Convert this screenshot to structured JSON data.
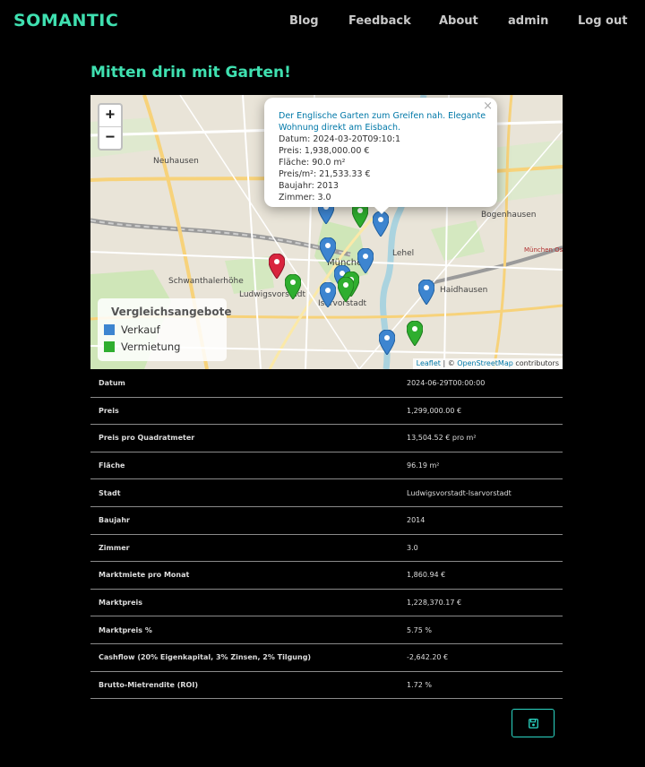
{
  "nav": {
    "brand": "SOMANTIC",
    "links": [
      "Blog",
      "Feedback",
      "About",
      "admin",
      "Log out"
    ]
  },
  "page": {
    "title": "Mitten drin mit Garten!"
  },
  "map": {
    "zoom_in": "+",
    "zoom_out": "−",
    "place_labels": [
      "Neuhausen",
      "Bogenhausen",
      "Schwanthalerhöhe",
      "Ludwigsvorstadt",
      "Isarvorstadt",
      "München",
      "Lehel",
      "Haidhausen",
      "München Ost"
    ],
    "popup": {
      "close": "×",
      "link_text": "Der Englische Garten zum Greifen nah. Elegante Wohnung direkt am Eisbach.",
      "lines": [
        "Datum: 2024-03-20T09:10:1",
        "Preis: 1,938,000.00 €",
        "Fläche: 90.0 m²",
        "Preis/m²: 21,533.33 €",
        "Baujahr: 2013",
        "Zimmer: 3.0"
      ]
    },
    "legend": {
      "title": "Vergleichsangebote",
      "items": [
        {
          "label": "Verkauf",
          "color": "#3d85d0"
        },
        {
          "label": "Vermietung",
          "color": "#2fae2f"
        }
      ]
    },
    "attribution": {
      "leaflet": "Leaflet",
      "separator": " | © ",
      "osm": "OpenStreetMap",
      "rest": " contributors"
    },
    "colors": {
      "sale": "#3d85d0",
      "rent": "#2fae2f",
      "current": "#d9243e"
    }
  },
  "details": [
    {
      "key": "Datum",
      "value": "2024-06-29T00:00:00"
    },
    {
      "key": "Preis",
      "value": "1,299,000.00 €"
    },
    {
      "key": "Preis pro Quadratmeter",
      "value": "13,504.52 € pro m²"
    },
    {
      "key": "Fläche",
      "value": "96.19 m²"
    },
    {
      "key": "Stadt",
      "value": "Ludwigsvorstadt-Isarvorstadt"
    },
    {
      "key": "Baujahr",
      "value": "2014"
    },
    {
      "key": "Zimmer",
      "value": "3.0"
    },
    {
      "key": "Marktmiete pro Monat",
      "value": "1,860.94 €"
    },
    {
      "key": "Marktpreis",
      "value": "1,228,370.17 €"
    },
    {
      "key": "Marktpreis %",
      "value": "5.75 %"
    },
    {
      "key": "Cashflow (20% Eigenkapital, 3% Zinsen, 2% Tilgung)",
      "value": "-2,642.20 €"
    },
    {
      "key": "Brutto-Mietrendite (ROI)",
      "value": "1.72 %"
    }
  ],
  "actions": {
    "save_icon": "save-icon"
  }
}
